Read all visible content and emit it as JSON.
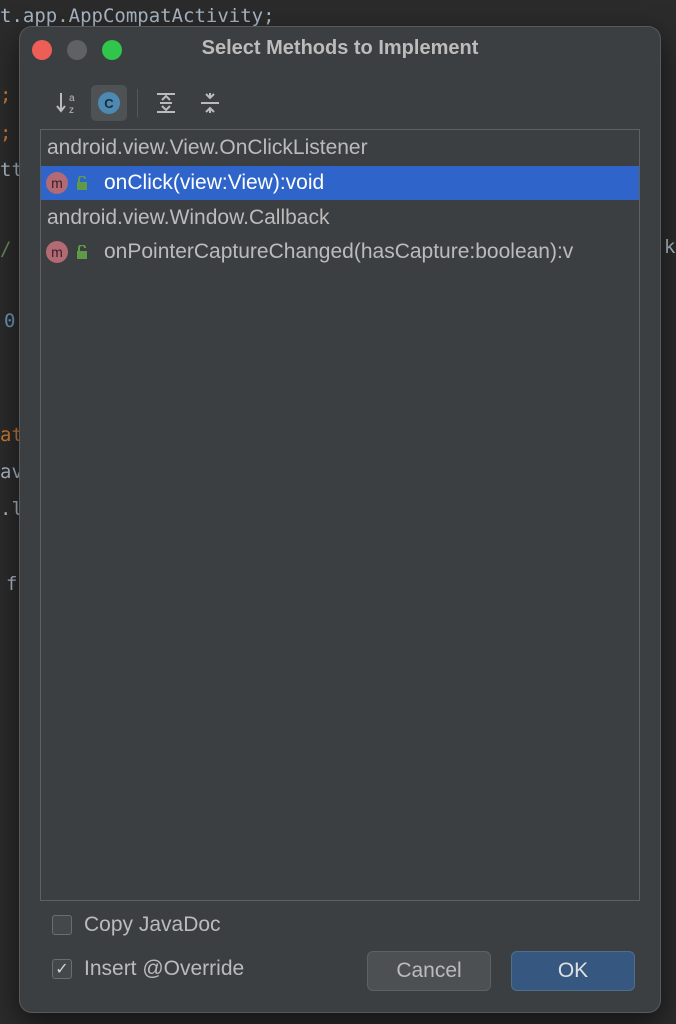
{
  "editor": {
    "top_line": "t.app.AppCompatActivity;",
    "fragments": [
      ";",
      ";",
      "tt",
      "/",
      "0",
      "at",
      "av",
      ".l",
      "f"
    ],
    "right_fragment": "k"
  },
  "dialog": {
    "title": "Select Methods to Implement",
    "toolbar": {
      "sort_alpha_icon": "sort-alphabetically-icon",
      "class_icon_letter": "C",
      "expand_icon": "expand-all-icon",
      "collapse_icon": "collapse-all-icon"
    },
    "tree": [
      {
        "type": "group",
        "label": "android.view.View.OnClickListener"
      },
      {
        "type": "method",
        "label": "onClick(view:View):void",
        "selected": true,
        "icon_letter": "m"
      },
      {
        "type": "group",
        "label": "android.view.Window.Callback"
      },
      {
        "type": "method",
        "label": "onPointerCaptureChanged(hasCapture:boolean):v",
        "selected": false,
        "icon_letter": "m"
      }
    ],
    "options": {
      "copy_javadoc": {
        "label": "Copy JavaDoc",
        "checked": false
      },
      "insert_override": {
        "label": "Insert @Override",
        "checked": true,
        "check_mark": "✓"
      }
    },
    "buttons": {
      "cancel": "Cancel",
      "ok": "OK"
    }
  },
  "colors": {
    "selection": "#2f65ca",
    "dialog_bg": "#3c3f41",
    "ok_button": "#365880",
    "close": "#ee5e57",
    "maximize": "#2fc64b"
  }
}
